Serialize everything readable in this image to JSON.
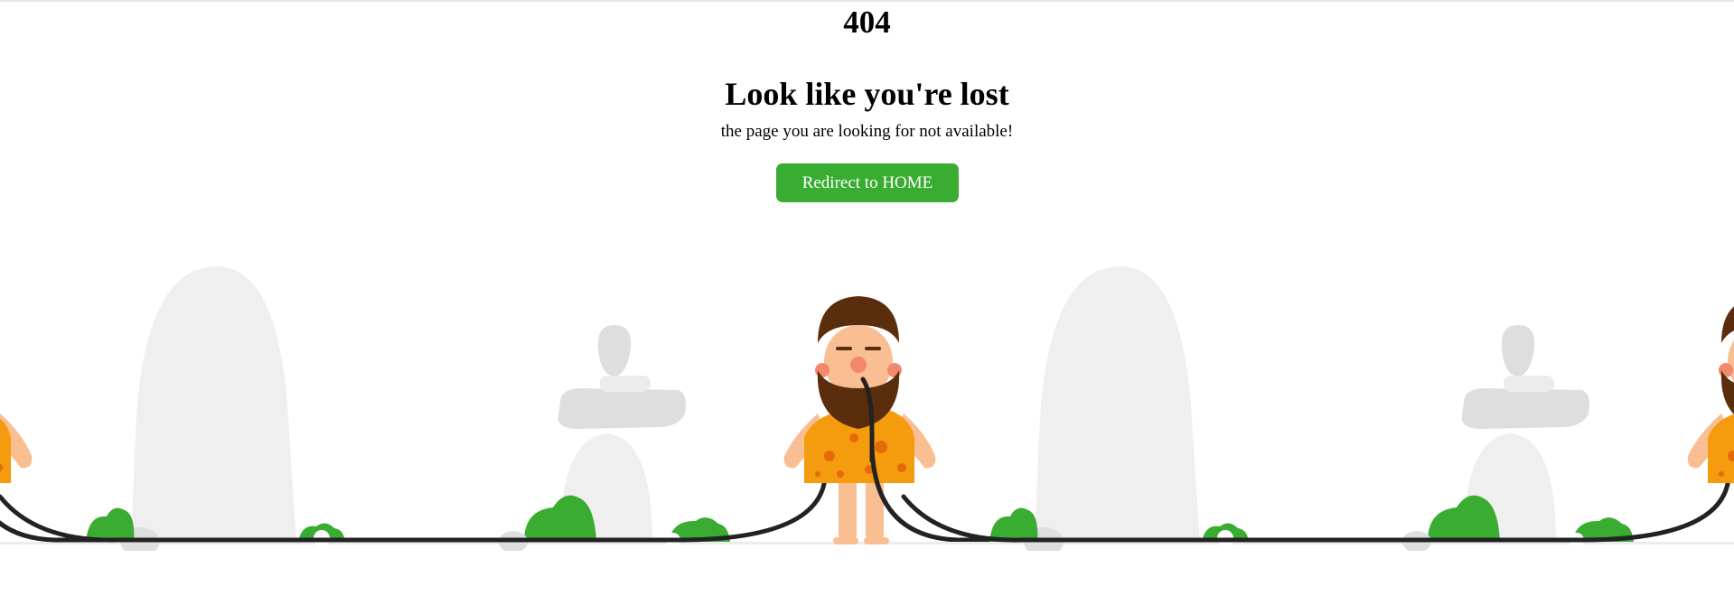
{
  "error_code": "404",
  "title": "Look like you're lost",
  "subtitle": "the page you are looking for not available!",
  "button_label": "Redirect to HOME",
  "illustration": "caveman-with-cable-icon",
  "colors": {
    "button_bg": "#39ac31",
    "button_text": "#ffffff",
    "stone": "#efefef",
    "bush": "#39ac31",
    "hide": "#f49b0e",
    "skin": "#f9be92",
    "hair": "#5a2d0c",
    "cable": "#222222"
  }
}
